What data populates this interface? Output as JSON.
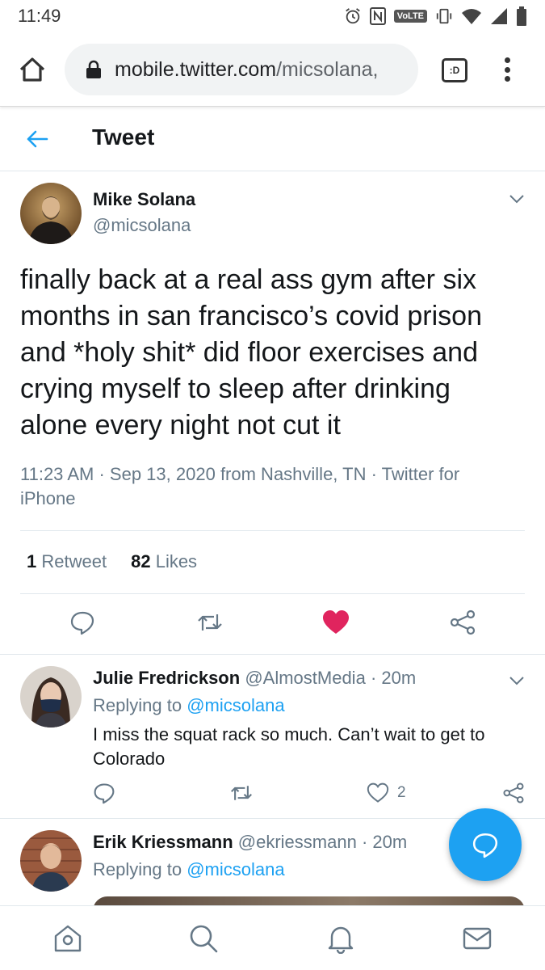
{
  "status_bar": {
    "time": "11:49",
    "volte_label": "VoLTE",
    "icons": [
      "alarm-icon",
      "nfc-icon",
      "volte-icon",
      "vibrate-icon",
      "wifi-icon",
      "signal-icon",
      "battery-icon"
    ]
  },
  "browser": {
    "url_host": "mobile.twitter.com",
    "url_path": "/micsolana,",
    "tabs_label": ":D",
    "icons": [
      "home-icon",
      "lock-icon",
      "tab-switcher-icon",
      "overflow-menu-icon"
    ]
  },
  "header": {
    "title": "Tweet",
    "back_icon": "back-arrow-icon"
  },
  "main_tweet": {
    "name": "Mike Solana",
    "handle": "@micsolana",
    "text": "finally back at a real ass gym after six months in san francisco’s covid prison and *holy shit* did floor exercises and crying myself to sleep after drinking alone every night not cut it",
    "meta_time": "11:23 AM",
    "meta_sep1": "·",
    "meta_date": "Sep 13, 2020",
    "meta_location": "from Nashville, TN",
    "meta_sep2": "·",
    "meta_source": "Twitter for iPhone",
    "retweet_count": "1",
    "retweet_label": "Retweet",
    "like_count": "82",
    "like_label": "Likes",
    "liked": true,
    "like_color": "#e0245e"
  },
  "replies": [
    {
      "name": "Julie Fredrickson",
      "handle": "@AlmostMedia",
      "sep": "·",
      "time": "20m",
      "replying_prefix": "Replying to",
      "replying_to": "@micsolana",
      "text": "I miss the squat rack so much. Can’t wait to get to Colorado",
      "like_count": "2"
    },
    {
      "name": "Erik Kriessmann",
      "handle": "@ekriessmann",
      "sep": "·",
      "time": "20m",
      "replying_prefix": "Replying to",
      "replying_to": "@micsolana"
    }
  ],
  "fab": {
    "icon": "compose-reply-icon",
    "color": "#1da1f2"
  },
  "bottom_nav": {
    "items": [
      "home-nav-icon",
      "search-nav-icon",
      "notifications-nav-icon",
      "messages-nav-icon"
    ]
  },
  "colors": {
    "accent": "#1da1f2",
    "secondary_text": "#657786",
    "primary_text": "#14171a"
  }
}
